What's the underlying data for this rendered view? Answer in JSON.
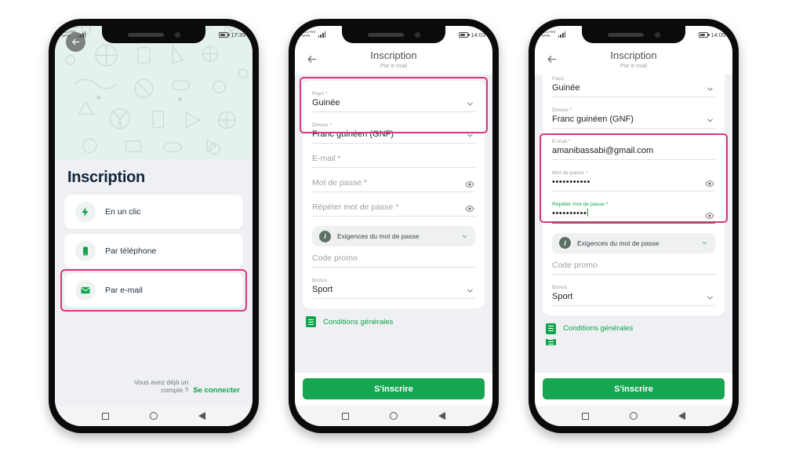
{
  "phones": [
    {
      "id": "phone-selection",
      "status": {
        "carrier_line1": "CELTIIS",
        "carrier_line2": "MTN",
        "time": "17:35"
      },
      "screen": {
        "title": "Inscription",
        "options": [
          {
            "label": "En un clic",
            "icon": "bolt-icon"
          },
          {
            "label": "Par téléphone",
            "icon": "phone-icon"
          },
          {
            "label": "Par e-mail",
            "icon": "envelope-icon"
          }
        ],
        "footer": {
          "question": "Vous avez déjà un compte ?",
          "link": "Se connecter"
        },
        "highlighted_option_index": 2
      }
    },
    {
      "id": "phone-form-empty",
      "status": {
        "carrier_line1": "CELTIIS",
        "carrier_line2": "MTN",
        "time": "14:03"
      },
      "appbar": {
        "title": "Inscription",
        "subtitle": "Par e-mail"
      },
      "fields": [
        {
          "label": "Pays *",
          "value": "Guinée",
          "type": "select",
          "focused": false
        },
        {
          "label": "Devise *",
          "value": "Franc guinéen (GNF)",
          "type": "select",
          "focused": false
        },
        {
          "label": "",
          "placeholder": "E-mail *",
          "value": "",
          "type": "text",
          "focused": false
        },
        {
          "label": "",
          "placeholder": "Mot de passe *",
          "value": "",
          "type": "password",
          "focused": false
        },
        {
          "label": "",
          "placeholder": "Répéter mot de passe *",
          "value": "",
          "type": "password",
          "focused": false
        }
      ],
      "info": {
        "label": "Exigences du mot de passe",
        "icon": "info-icon"
      },
      "fields2": [
        {
          "label": "",
          "placeholder": "Code promo",
          "value": "",
          "type": "text"
        },
        {
          "label": "Bonus",
          "value": "Sport",
          "type": "select"
        }
      ],
      "terms": {
        "label": "Conditions générales",
        "icon": "document-icon"
      },
      "cta": "S'inscrire"
    },
    {
      "id": "phone-form-filled",
      "status": {
        "carrier_line1": "CELTIIS",
        "carrier_line2": "MTN",
        "time": "14:05"
      },
      "appbar": {
        "title": "Inscription",
        "subtitle": "Par e-mail"
      },
      "fields": [
        {
          "label": "Pays",
          "value": "Guinée",
          "type": "select",
          "focused": false
        },
        {
          "label": "Devise *",
          "value": "Franc guinéen (GNF)",
          "type": "select",
          "focused": false
        },
        {
          "label": "E-mail *",
          "value": "amanibassabi@gmail.com",
          "type": "text",
          "focused": false
        },
        {
          "label": "Mot de passe *",
          "value": "•••••••••••",
          "type": "password",
          "focused": false
        },
        {
          "label": "Répéter mot de passe *",
          "value": "••••••••••",
          "type": "password",
          "focused": true
        }
      ],
      "info": {
        "label": "Exigences du mot de passe",
        "icon": "info-icon"
      },
      "fields2": [
        {
          "label": "",
          "placeholder": "Code promo",
          "value": "",
          "type": "text"
        },
        {
          "label": "Bonus",
          "value": "Sport",
          "type": "select"
        }
      ],
      "terms": {
        "label": "Conditions générales",
        "icon": "document-icon"
      },
      "cta": "S'inscrire"
    }
  ],
  "colors": {
    "brand_green": "#16a550",
    "highlight_pink": "#d8367f",
    "hero_mint": "#e4f1ec",
    "page_bg": "#eff0f4"
  }
}
